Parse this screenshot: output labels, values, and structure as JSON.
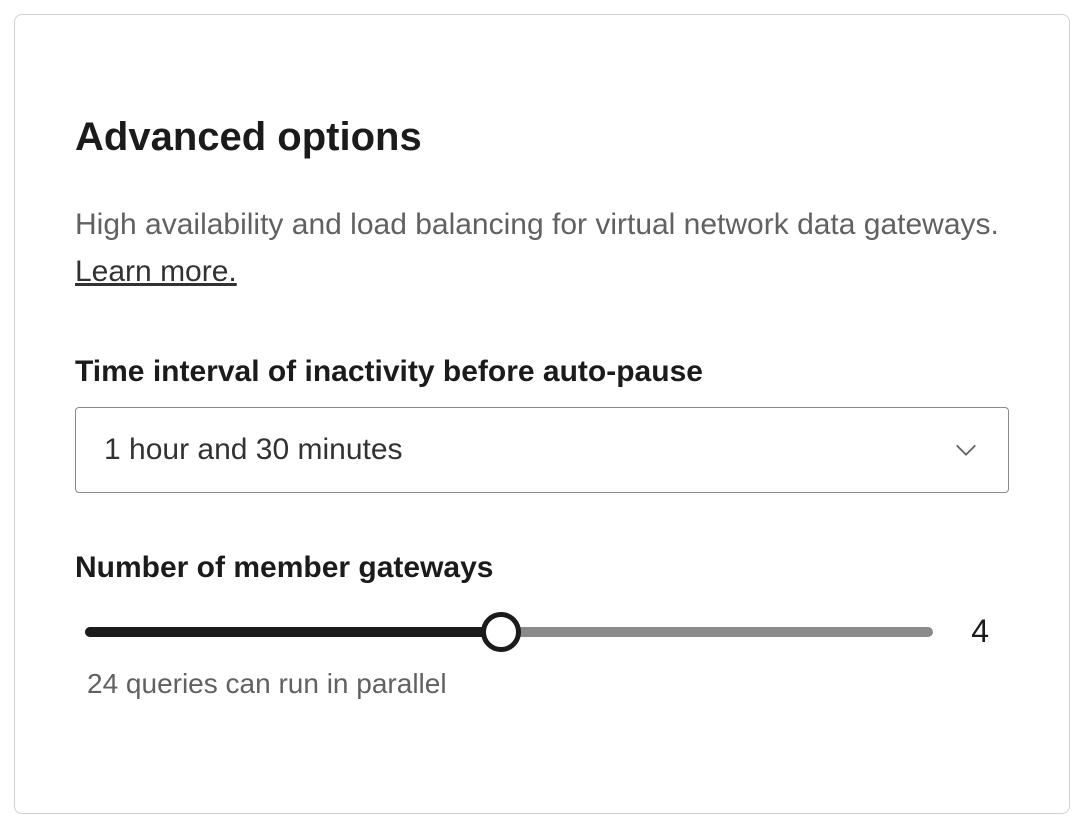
{
  "heading": "Advanced options",
  "description_prefix": "High availability and load balancing for virtual network data gateways. ",
  "learn_more": "Learn more.",
  "time_interval": {
    "label": "Time interval of inactivity before auto-pause",
    "selected": "1 hour and 30 minutes"
  },
  "member_gateways": {
    "label": "Number of member gateways",
    "value": "4",
    "hint": "24 queries can run in parallel"
  }
}
